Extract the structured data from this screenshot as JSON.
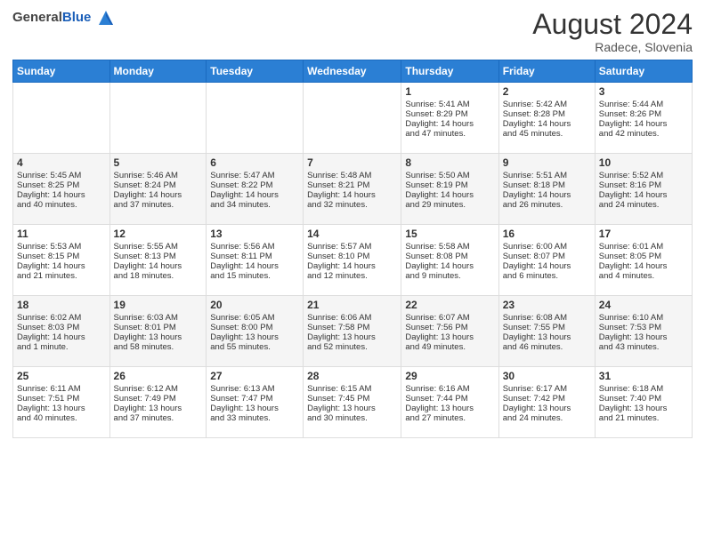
{
  "header": {
    "logo_general": "General",
    "logo_blue": "Blue",
    "month_year": "August 2024",
    "location": "Radece, Slovenia"
  },
  "days_of_week": [
    "Sunday",
    "Monday",
    "Tuesday",
    "Wednesday",
    "Thursday",
    "Friday",
    "Saturday"
  ],
  "weeks": [
    [
      {
        "day": "",
        "info": ""
      },
      {
        "day": "",
        "info": ""
      },
      {
        "day": "",
        "info": ""
      },
      {
        "day": "",
        "info": ""
      },
      {
        "day": "1",
        "info": "Sunrise: 5:41 AM\nSunset: 8:29 PM\nDaylight: 14 hours\nand 47 minutes."
      },
      {
        "day": "2",
        "info": "Sunrise: 5:42 AM\nSunset: 8:28 PM\nDaylight: 14 hours\nand 45 minutes."
      },
      {
        "day": "3",
        "info": "Sunrise: 5:44 AM\nSunset: 8:26 PM\nDaylight: 14 hours\nand 42 minutes."
      }
    ],
    [
      {
        "day": "4",
        "info": "Sunrise: 5:45 AM\nSunset: 8:25 PM\nDaylight: 14 hours\nand 40 minutes."
      },
      {
        "day": "5",
        "info": "Sunrise: 5:46 AM\nSunset: 8:24 PM\nDaylight: 14 hours\nand 37 minutes."
      },
      {
        "day": "6",
        "info": "Sunrise: 5:47 AM\nSunset: 8:22 PM\nDaylight: 14 hours\nand 34 minutes."
      },
      {
        "day": "7",
        "info": "Sunrise: 5:48 AM\nSunset: 8:21 PM\nDaylight: 14 hours\nand 32 minutes."
      },
      {
        "day": "8",
        "info": "Sunrise: 5:50 AM\nSunset: 8:19 PM\nDaylight: 14 hours\nand 29 minutes."
      },
      {
        "day": "9",
        "info": "Sunrise: 5:51 AM\nSunset: 8:18 PM\nDaylight: 14 hours\nand 26 minutes."
      },
      {
        "day": "10",
        "info": "Sunrise: 5:52 AM\nSunset: 8:16 PM\nDaylight: 14 hours\nand 24 minutes."
      }
    ],
    [
      {
        "day": "11",
        "info": "Sunrise: 5:53 AM\nSunset: 8:15 PM\nDaylight: 14 hours\nand 21 minutes."
      },
      {
        "day": "12",
        "info": "Sunrise: 5:55 AM\nSunset: 8:13 PM\nDaylight: 14 hours\nand 18 minutes."
      },
      {
        "day": "13",
        "info": "Sunrise: 5:56 AM\nSunset: 8:11 PM\nDaylight: 14 hours\nand 15 minutes."
      },
      {
        "day": "14",
        "info": "Sunrise: 5:57 AM\nSunset: 8:10 PM\nDaylight: 14 hours\nand 12 minutes."
      },
      {
        "day": "15",
        "info": "Sunrise: 5:58 AM\nSunset: 8:08 PM\nDaylight: 14 hours\nand 9 minutes."
      },
      {
        "day": "16",
        "info": "Sunrise: 6:00 AM\nSunset: 8:07 PM\nDaylight: 14 hours\nand 6 minutes."
      },
      {
        "day": "17",
        "info": "Sunrise: 6:01 AM\nSunset: 8:05 PM\nDaylight: 14 hours\nand 4 minutes."
      }
    ],
    [
      {
        "day": "18",
        "info": "Sunrise: 6:02 AM\nSunset: 8:03 PM\nDaylight: 14 hours\nand 1 minute."
      },
      {
        "day": "19",
        "info": "Sunrise: 6:03 AM\nSunset: 8:01 PM\nDaylight: 13 hours\nand 58 minutes."
      },
      {
        "day": "20",
        "info": "Sunrise: 6:05 AM\nSunset: 8:00 PM\nDaylight: 13 hours\nand 55 minutes."
      },
      {
        "day": "21",
        "info": "Sunrise: 6:06 AM\nSunset: 7:58 PM\nDaylight: 13 hours\nand 52 minutes."
      },
      {
        "day": "22",
        "info": "Sunrise: 6:07 AM\nSunset: 7:56 PM\nDaylight: 13 hours\nand 49 minutes."
      },
      {
        "day": "23",
        "info": "Sunrise: 6:08 AM\nSunset: 7:55 PM\nDaylight: 13 hours\nand 46 minutes."
      },
      {
        "day": "24",
        "info": "Sunrise: 6:10 AM\nSunset: 7:53 PM\nDaylight: 13 hours\nand 43 minutes."
      }
    ],
    [
      {
        "day": "25",
        "info": "Sunrise: 6:11 AM\nSunset: 7:51 PM\nDaylight: 13 hours\nand 40 minutes."
      },
      {
        "day": "26",
        "info": "Sunrise: 6:12 AM\nSunset: 7:49 PM\nDaylight: 13 hours\nand 37 minutes."
      },
      {
        "day": "27",
        "info": "Sunrise: 6:13 AM\nSunset: 7:47 PM\nDaylight: 13 hours\nand 33 minutes."
      },
      {
        "day": "28",
        "info": "Sunrise: 6:15 AM\nSunset: 7:45 PM\nDaylight: 13 hours\nand 30 minutes."
      },
      {
        "day": "29",
        "info": "Sunrise: 6:16 AM\nSunset: 7:44 PM\nDaylight: 13 hours\nand 27 minutes."
      },
      {
        "day": "30",
        "info": "Sunrise: 6:17 AM\nSunset: 7:42 PM\nDaylight: 13 hours\nand 24 minutes."
      },
      {
        "day": "31",
        "info": "Sunrise: 6:18 AM\nSunset: 7:40 PM\nDaylight: 13 hours\nand 21 minutes."
      }
    ]
  ]
}
